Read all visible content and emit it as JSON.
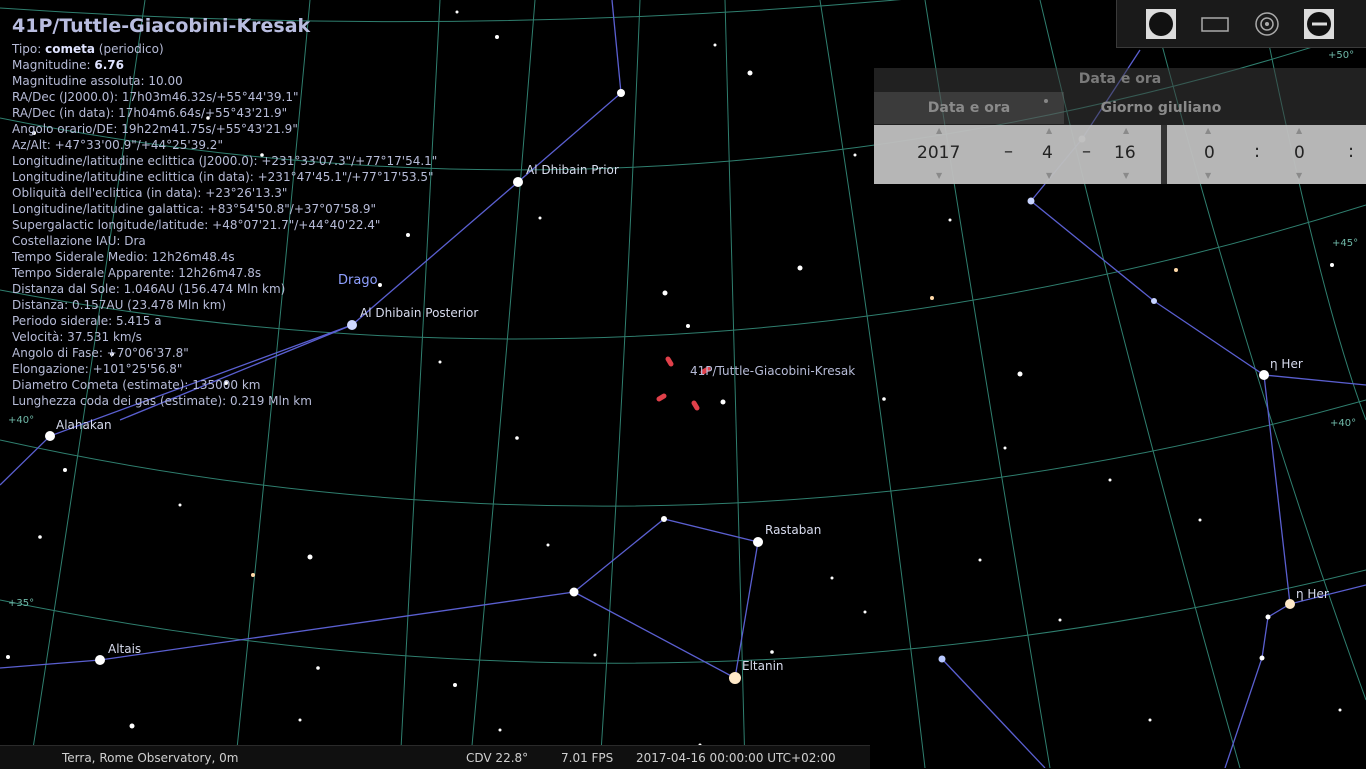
{
  "object": {
    "title": "41P/Tuttle-Giacobini-Kresak",
    "rows": [
      {
        "label": "Tipo: ",
        "bold": "cometa",
        "rest": " (periodico)"
      },
      {
        "label": "Magnitudine: ",
        "bold": "6.76",
        "rest": ""
      },
      {
        "label": "Magnitudine assoluta: 10.00",
        "bold": "",
        "rest": ""
      },
      {
        "label": "RA/Dec (J2000.0): 17h03m46.32s/+55°44'39.1\"",
        "bold": "",
        "rest": ""
      },
      {
        "label": "RA/Dec (in data): 17h04m6.64s/+55°43'21.9\"",
        "bold": "",
        "rest": ""
      },
      {
        "label": "Angolo orario/DE: 19h22m41.75s/+55°43'21.9\"",
        "bold": "",
        "rest": ""
      },
      {
        "label": "Az/Alt: +47°33'00.9\"/+44°25'39.2\"",
        "bold": "",
        "rest": ""
      },
      {
        "label": "Longitudine/latitudine eclittica (J2000.0): +231°33'07.3\"/+77°17'54.1\"",
        "bold": "",
        "rest": ""
      },
      {
        "label": "Longitudine/latitudine eclittica (in data): +231°47'45.1\"/+77°17'53.5\"",
        "bold": "",
        "rest": ""
      },
      {
        "label": "Obliquità dell'eclittica (in data): +23°26'13.3\"",
        "bold": "",
        "rest": ""
      },
      {
        "label": "Longitudine/latitudine galattica: +83°54'50.8\"/+37°07'58.9\"",
        "bold": "",
        "rest": ""
      },
      {
        "label": "Supergalactic longitude/latitude: +48°07'21.7\"/+44°40'22.4\"",
        "bold": "",
        "rest": ""
      },
      {
        "label": "Costellazione IAU: Dra",
        "bold": "",
        "rest": ""
      },
      {
        "label": "Tempo Siderale Medio: 12h26m48.4s",
        "bold": "",
        "rest": ""
      },
      {
        "label": "Tempo Siderale Apparente: 12h26m47.8s",
        "bold": "",
        "rest": ""
      },
      {
        "label": "Distanza dal Sole: 1.046AU (156.474 Mln km)",
        "bold": "",
        "rest": ""
      },
      {
        "label": "Distanza: 0.157AU (23.478 Mln km)",
        "bold": "",
        "rest": ""
      },
      {
        "label": "Periodo siderale: 5.415 a",
        "bold": "",
        "rest": ""
      },
      {
        "label": "Velocità: 37.531 km/s",
        "bold": "",
        "rest": ""
      },
      {
        "label": "Angolo di Fase: +70°06'37.8\"",
        "bold": "",
        "rest": ""
      },
      {
        "label": "Elongazione: +101°25'56.8\"",
        "bold": "",
        "rest": ""
      },
      {
        "label": "Diametro Cometa (estimate): 135000 km",
        "bold": "",
        "rest": ""
      },
      {
        "label": "Lunghezza coda dei gas (estimate): 0.219 Mln km",
        "bold": "",
        "rest": ""
      }
    ]
  },
  "sky_labels": {
    "al_dhibain_prior": "Al Dhibain Prior",
    "drago": "Drago",
    "al_dhibain_posterior": "Al Dhibain Posterior",
    "comet": "41P/Tuttle-Giacobini-Kresak",
    "alahakan": "Alahakan",
    "rastaban": "Rastaban",
    "altais": "Altais",
    "eltanin": "Eltanin",
    "eta_her": "η Her",
    "eta_her_2": "η Her"
  },
  "grid_labels": {
    "g40a": "+40°",
    "g35": "+35°",
    "g40b": "+40°",
    "g45": "+45°",
    "g50": "+50°"
  },
  "datetime_panel": {
    "title": "Data e ora",
    "tab_date": "Data e ora",
    "tab_julian": "Giorno giuliano",
    "year": "2017",
    "month": "4",
    "day": "16",
    "hour": "0",
    "minute": "0",
    "dash": "–",
    "colon": ":"
  },
  "status_bar": {
    "location": "Terra, Rome Observatory, 0m",
    "fov": "CDV 22.8°",
    "fps": "7.01 FPS",
    "datetime": "2017-04-16 00:00:00 UTC+02:00"
  },
  "colors": {
    "background": "#000000",
    "grid": "#2f7f6f",
    "constellation_lines": "#5a5fd0",
    "info_text": "#b7bcd8",
    "comet_marker": "#e0404a"
  }
}
